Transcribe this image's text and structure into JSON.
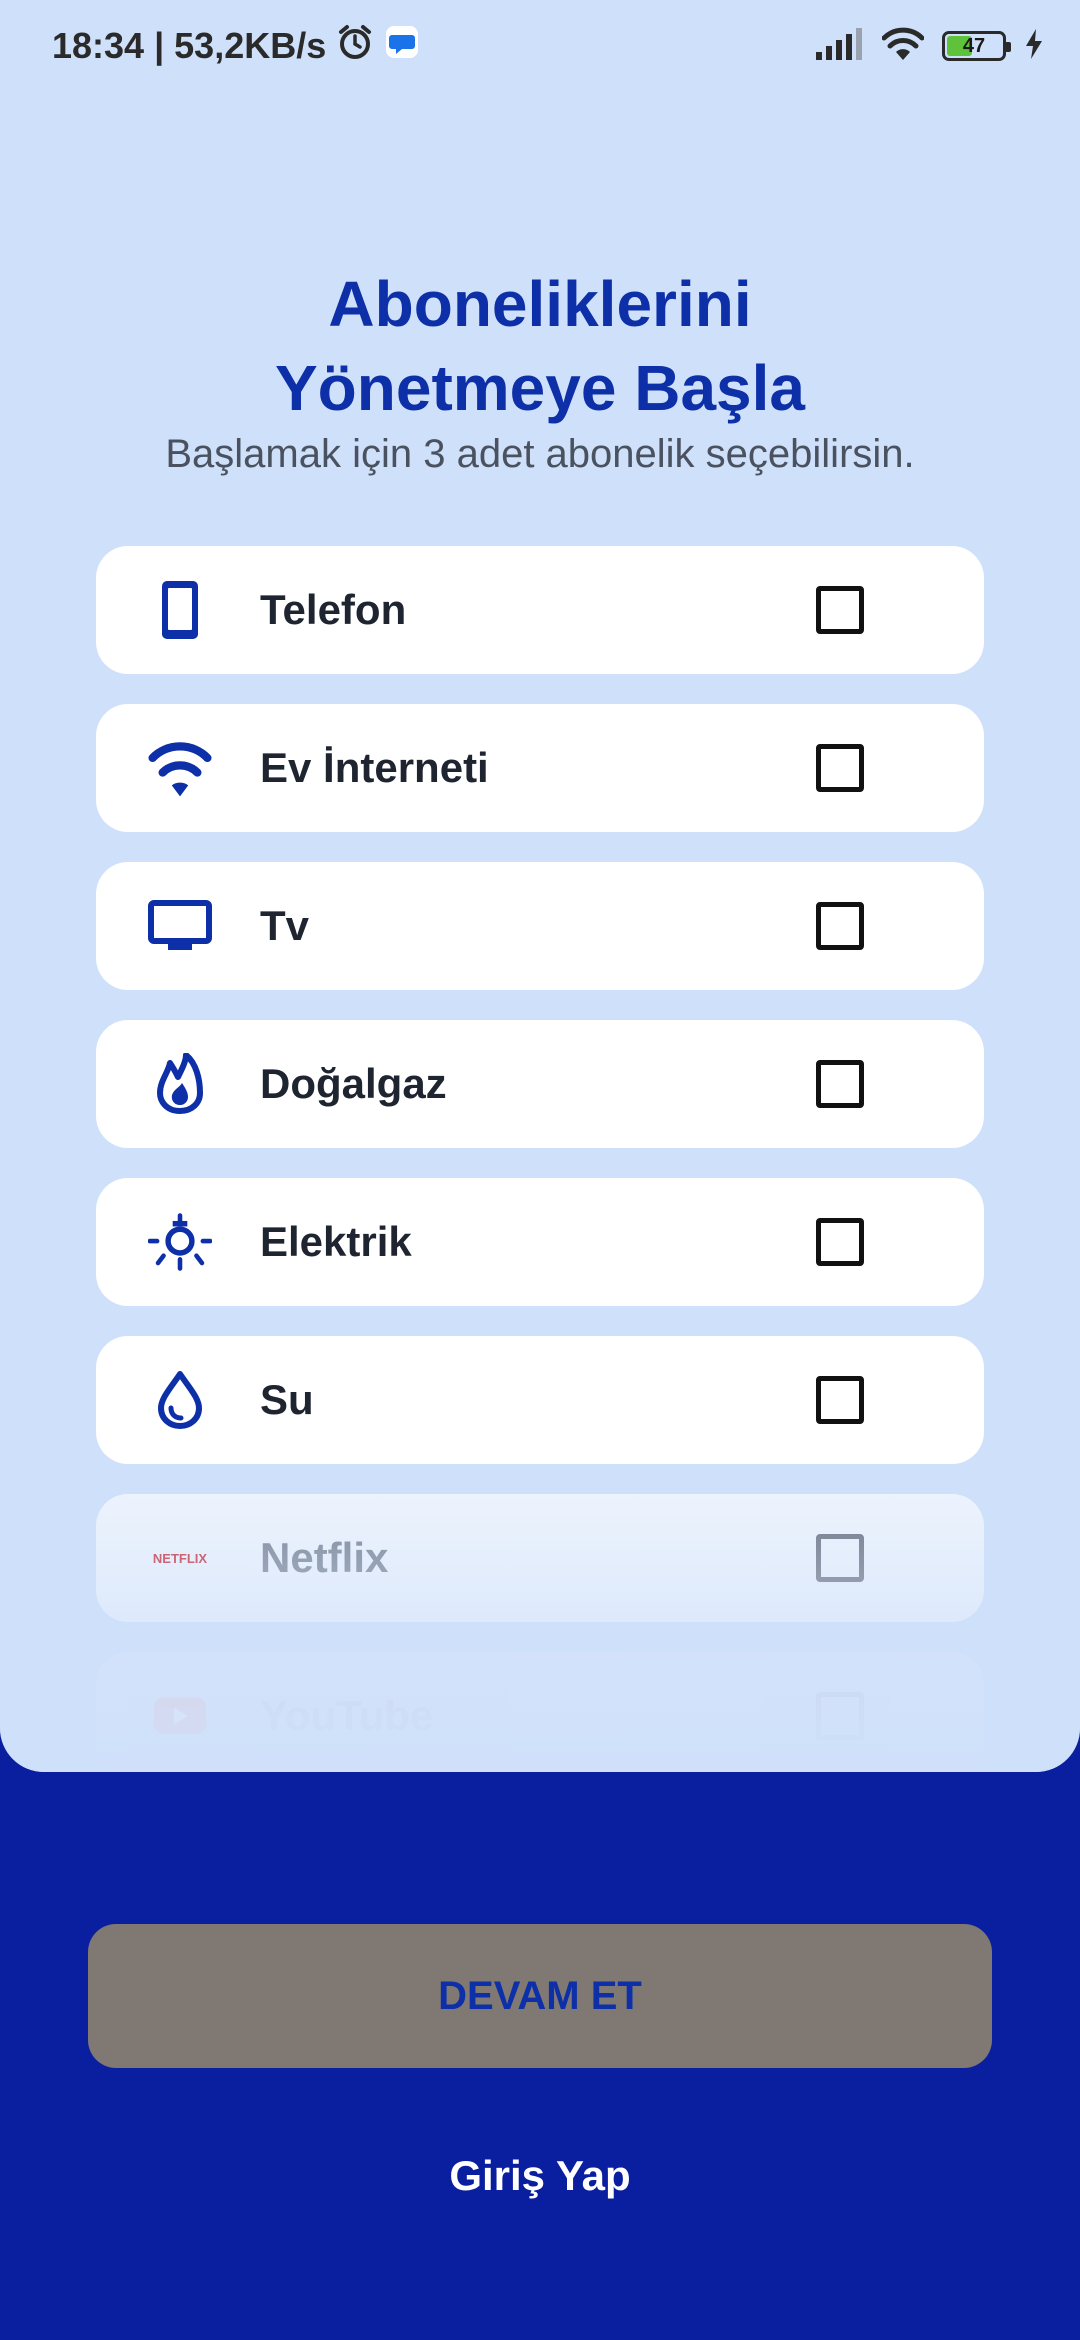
{
  "status_bar": {
    "time_speed": "18:34 | 53,2KB/s",
    "battery": "47",
    "battery_fraction": 0.47
  },
  "header": {
    "title_line1": "Aboneliklerini",
    "title_line2": "Yönetmeye Başla",
    "subtitle": "Başlamak için 3 adet abonelik seçebilirsin."
  },
  "subscriptions": [
    {
      "label": "Telefon",
      "icon": "phone-icon",
      "checked": false
    },
    {
      "label": "Ev İnterneti",
      "icon": "wifi-icon",
      "checked": false
    },
    {
      "label": "Tv",
      "icon": "tv-icon",
      "checked": false
    },
    {
      "label": "Doğalgaz",
      "icon": "flame-icon",
      "checked": false
    },
    {
      "label": "Elektrik",
      "icon": "lightbulb-icon",
      "checked": false
    },
    {
      "label": "Su",
      "icon": "water-drop-icon",
      "checked": false
    },
    {
      "label": "Netflix",
      "icon": "netflix-logo",
      "logo_text": "NETFLIX",
      "checked": false
    },
    {
      "label": "YouTube",
      "icon": "youtube-logo",
      "checked": false
    }
  ],
  "actions": {
    "continue_label": "DEVAM ET",
    "login_label": "Giriş Yap"
  },
  "colors": {
    "primary": "#0d2fa8",
    "background_top": "#cfe0fa",
    "background_bottom": "#0a1fa0",
    "button_disabled": "#807873"
  }
}
